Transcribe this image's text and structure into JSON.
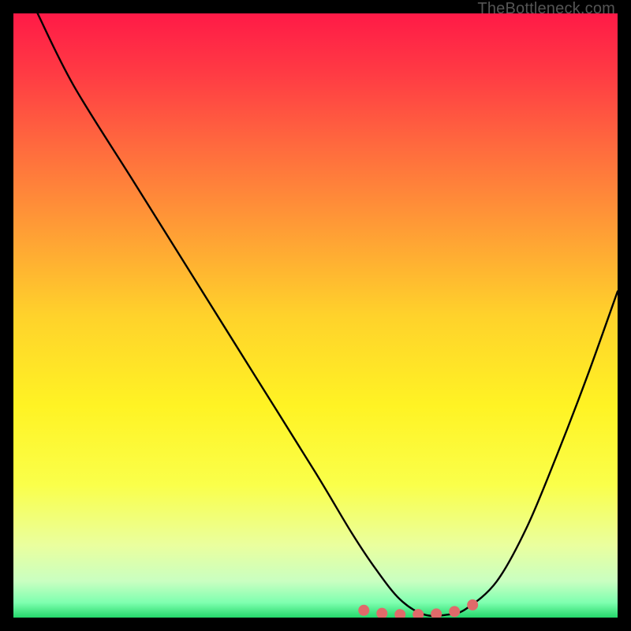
{
  "watermark": "TheBottleneck.com",
  "gradient_stops": [
    {
      "offset": 0.0,
      "color": "#ff1a47"
    },
    {
      "offset": 0.1,
      "color": "#ff3b44"
    },
    {
      "offset": 0.22,
      "color": "#ff6a3e"
    },
    {
      "offset": 0.35,
      "color": "#ff9a36"
    },
    {
      "offset": 0.5,
      "color": "#ffd22b"
    },
    {
      "offset": 0.65,
      "color": "#fff324"
    },
    {
      "offset": 0.78,
      "color": "#faff4a"
    },
    {
      "offset": 0.88,
      "color": "#eaff9e"
    },
    {
      "offset": 0.94,
      "color": "#c9ffc1"
    },
    {
      "offset": 0.975,
      "color": "#7fffb0"
    },
    {
      "offset": 1.0,
      "color": "#25d86b"
    }
  ],
  "chart_data": {
    "type": "line",
    "title": "",
    "xlabel": "",
    "ylabel": "",
    "xlim": [
      0,
      100
    ],
    "ylim": [
      0,
      100
    ],
    "grid": false,
    "series": [
      {
        "name": "bottleneck-curve",
        "x": [
          4,
          10,
          20,
          30,
          40,
          50,
          56,
          60,
          64,
          68,
          72,
          75,
          80,
          85,
          90,
          95,
          100
        ],
        "values": [
          100,
          88,
          72,
          56,
          40,
          24,
          14,
          8,
          3,
          0.5,
          0.5,
          1.5,
          6,
          15,
          27,
          40,
          54
        ]
      }
    ],
    "markers": {
      "name": "bottleneck-markers",
      "x": [
        58,
        61,
        64,
        67,
        70,
        73,
        76
      ],
      "values": [
        1.2,
        0.7,
        0.5,
        0.5,
        0.6,
        1.0,
        2.1
      ],
      "radius_px": 7,
      "color": "#e06a6a"
    }
  }
}
